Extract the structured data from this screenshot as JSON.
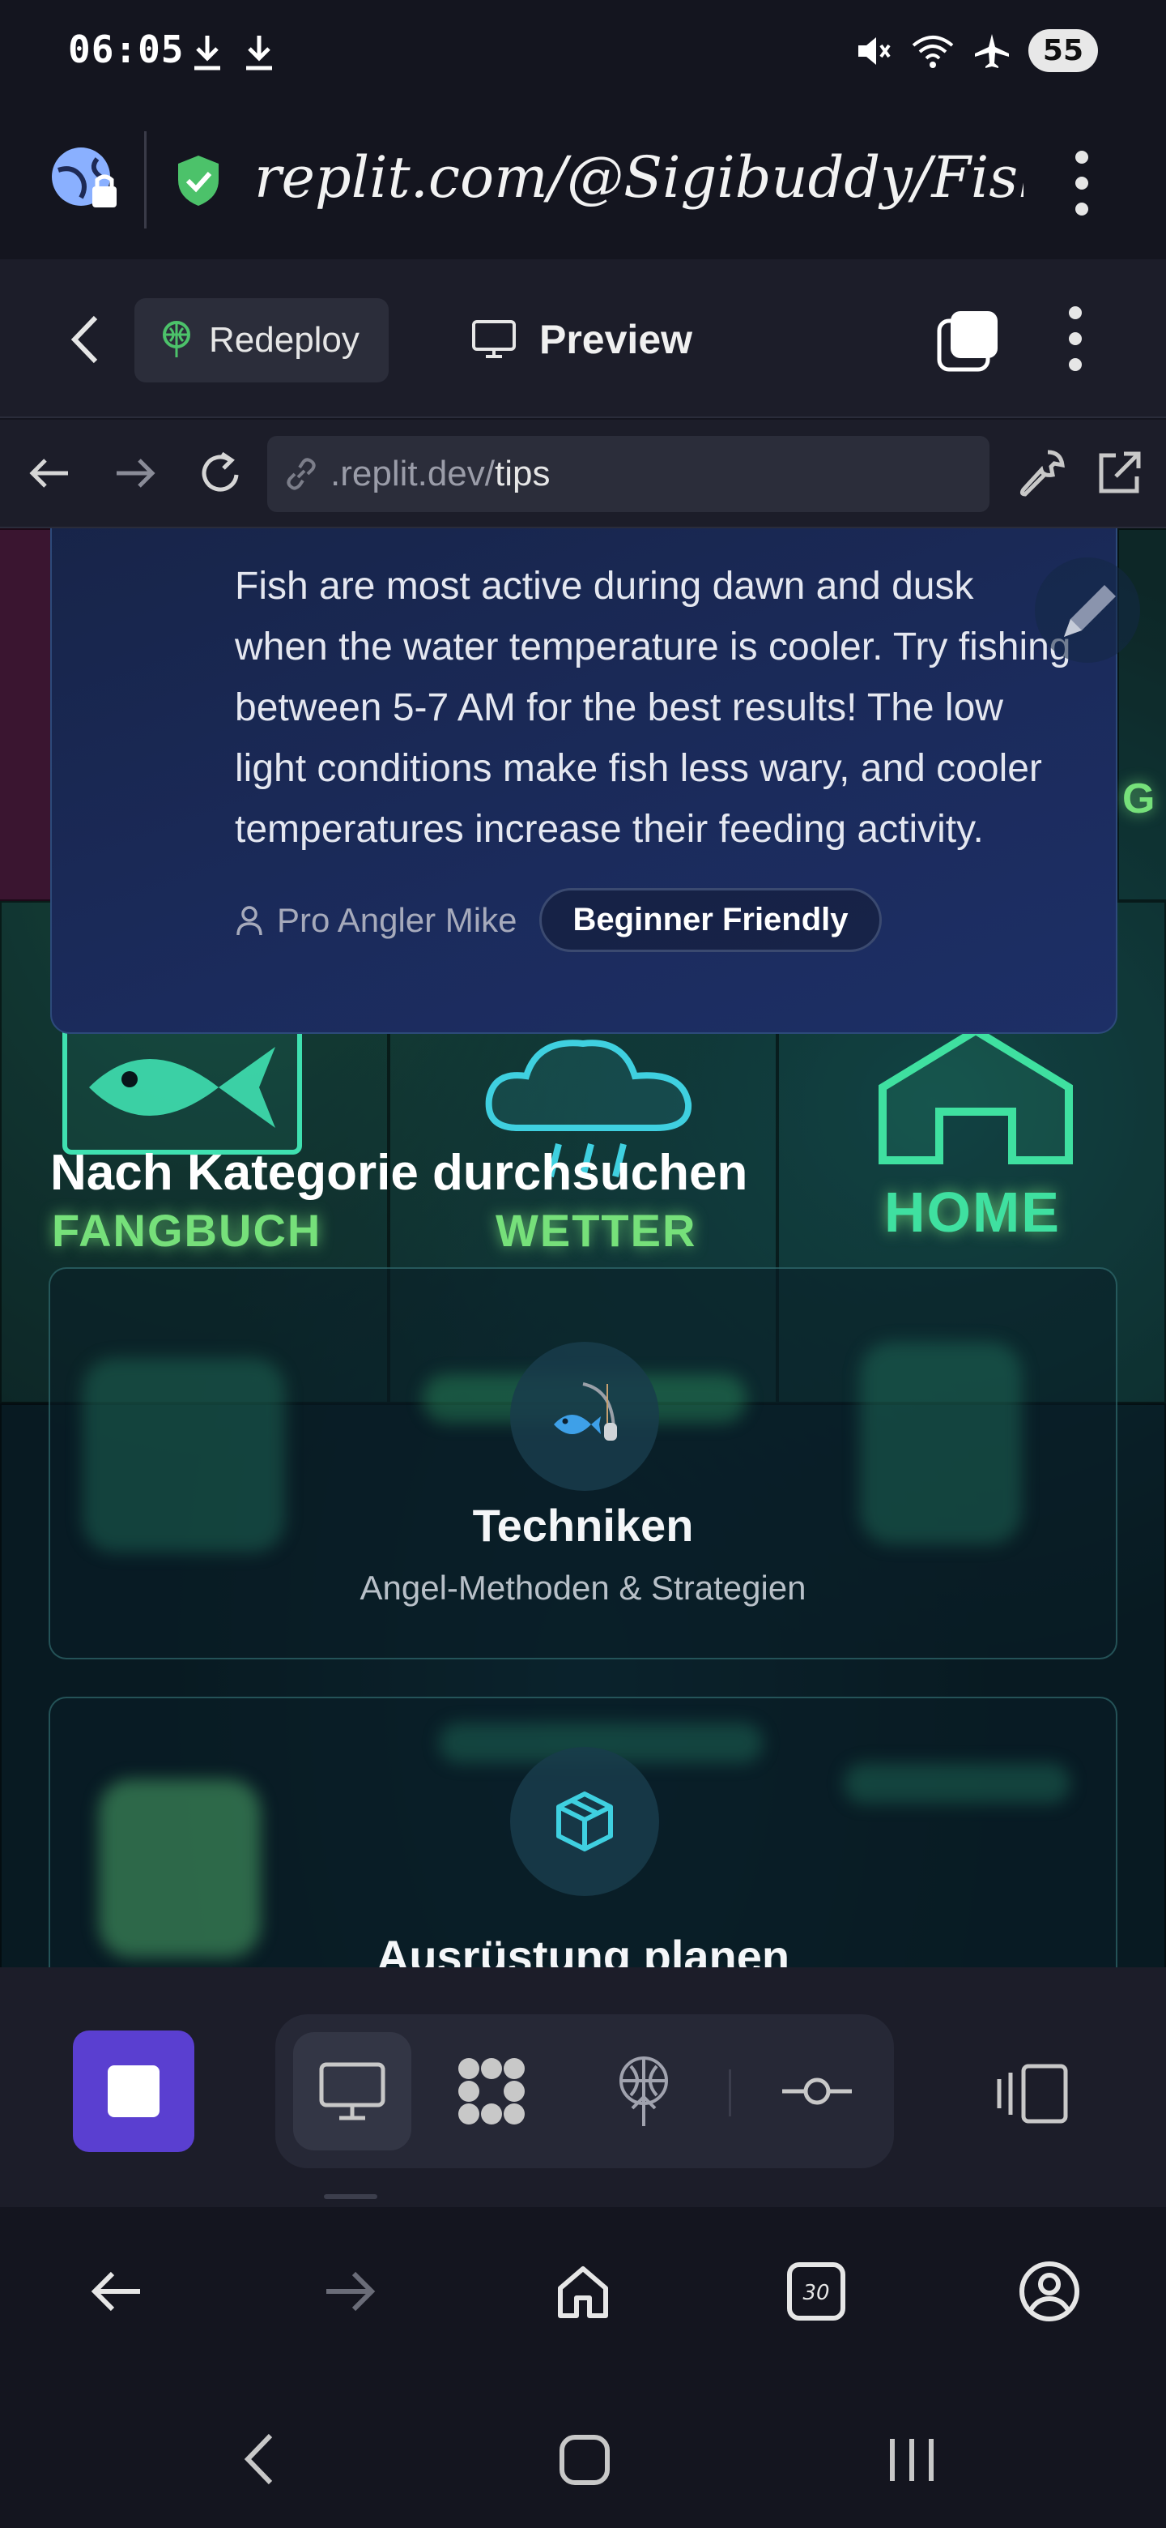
{
  "status_bar": {
    "time": "06:05",
    "battery": "55"
  },
  "browser": {
    "url": "replit.com/@Sigibuddy/Fish/"
  },
  "replit": {
    "redeploy_label": "Redeploy",
    "preview_label": "Preview"
  },
  "webview": {
    "url_prefix": ".replit.dev/",
    "url_path": "tips"
  },
  "page": {
    "tip": {
      "body": "Fish are most active during dawn and dusk when the water temperature is cooler. Try fishing between 5-7 AM for the best results! The low light conditions make fish less wary, and cooler temperatures increase their feeding activity.",
      "author": "Pro Angler Mike",
      "badge": "Beginner Friendly"
    },
    "section_title": "Nach Kategorie durchsuchen",
    "background_labels": [
      "FANGBUCH",
      "WETTER",
      "HOME",
      "G"
    ],
    "categories": [
      {
        "title": "Techniken",
        "subtitle": "Angel-Methoden & Strategien",
        "icon": "fishing-rod-icon"
      },
      {
        "title": "Ausrüstung planen",
        "subtitle": "",
        "icon": "box-icon"
      }
    ]
  },
  "colors": {
    "accent_purple": "#5a3fd0",
    "tip_card": "#1b2b5c",
    "neon_green": "#76e07a",
    "icon_cyan": "#3fd0e0"
  }
}
